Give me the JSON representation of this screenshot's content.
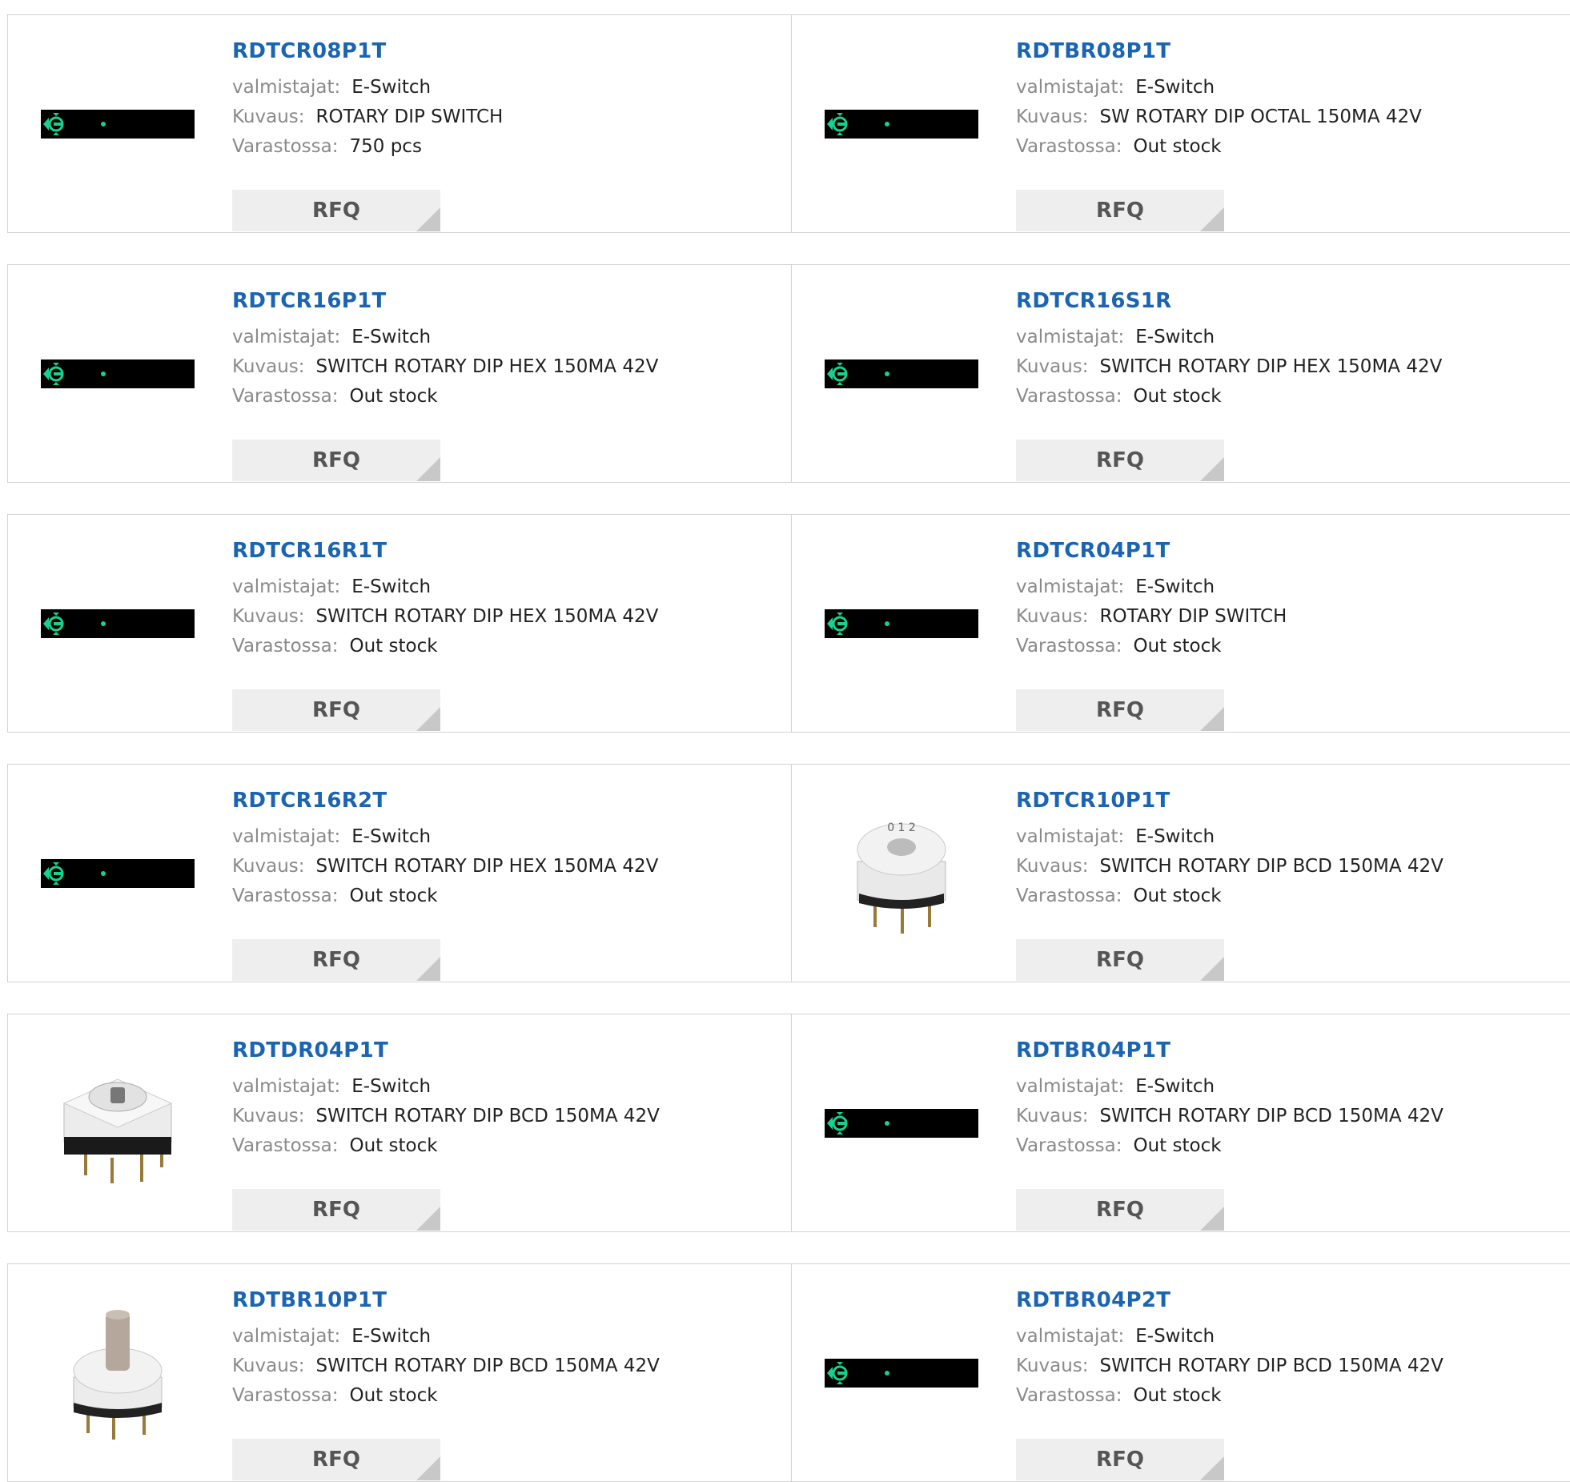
{
  "labels": {
    "manufacturer": "valmistajat:",
    "description": "Kuvaus:",
    "stock": "Varastossa:",
    "rfq": "RFQ"
  },
  "colors": {
    "part_link": "#1b64b1",
    "border": "#d3d3d3",
    "rfq_bg": "#eeeeee",
    "placeholder_icon": "#19d18f"
  },
  "products": [
    {
      "part": "RDTCR08P1T",
      "manufacturer": "E-Switch",
      "description": "ROTARY DIP SWITCH",
      "stock": "750 pcs",
      "image": "placeholder"
    },
    {
      "part": "RDTBR08P1T",
      "manufacturer": "E-Switch",
      "description": "SW ROTARY DIP OCTAL 150MA 42V",
      "stock": "Out stock",
      "image": "placeholder"
    },
    {
      "part": "RDTCR16P1T",
      "manufacturer": "E-Switch",
      "description": "SWITCH ROTARY DIP HEX 150MA 42V",
      "stock": "Out stock",
      "image": "placeholder"
    },
    {
      "part": "RDTCR16S1R",
      "manufacturer": "E-Switch",
      "description": "SWITCH ROTARY DIP HEX 150MA 42V",
      "stock": "Out stock",
      "image": "placeholder"
    },
    {
      "part": "RDTCR16R1T",
      "manufacturer": "E-Switch",
      "description": "SWITCH ROTARY DIP HEX 150MA 42V",
      "stock": "Out stock",
      "image": "placeholder"
    },
    {
      "part": "RDTCR04P1T",
      "manufacturer": "E-Switch",
      "description": "ROTARY DIP SWITCH",
      "stock": "Out stock",
      "image": "placeholder"
    },
    {
      "part": "RDTCR16R2T",
      "manufacturer": "E-Switch",
      "description": "SWITCH ROTARY DIP HEX 150MA 42V",
      "stock": "Out stock",
      "image": "placeholder"
    },
    {
      "part": "RDTCR10P1T",
      "manufacturer": "E-Switch",
      "description": "SWITCH ROTARY DIP BCD 150MA 42V",
      "stock": "Out stock",
      "image": "rotary-switch-top"
    },
    {
      "part": "RDTDR04P1T",
      "manufacturer": "E-Switch",
      "description": "SWITCH ROTARY DIP BCD 150MA 42V",
      "stock": "Out stock",
      "image": "rotary-switch-square"
    },
    {
      "part": "RDTBR04P1T",
      "manufacturer": "E-Switch",
      "description": "SWITCH ROTARY DIP BCD 150MA 42V",
      "stock": "Out stock",
      "image": "placeholder"
    },
    {
      "part": "RDTBR10P1T",
      "manufacturer": "E-Switch",
      "description": "SWITCH ROTARY DIP BCD 150MA 42V",
      "stock": "Out stock",
      "image": "rotary-switch-shaft"
    },
    {
      "part": "RDTBR04P2T",
      "manufacturer": "E-Switch",
      "description": "SWITCH ROTARY DIP BCD 150MA 42V",
      "stock": "Out stock",
      "image": "placeholder"
    }
  ]
}
